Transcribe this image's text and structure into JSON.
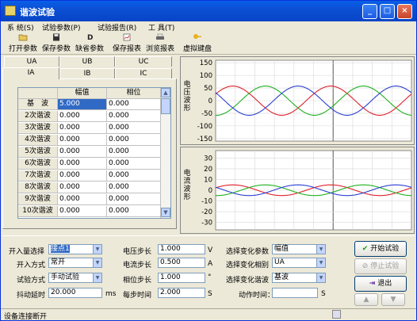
{
  "window": {
    "title": "谐波试验",
    "min": "_",
    "max": "□",
    "close": "×"
  },
  "menu": [
    "系 统(S)",
    "试验参数(P)",
    "试验报告(R)",
    "工 具(T)"
  ],
  "toolbar": [
    {
      "label": "打开参数",
      "icon": "folder-open-icon"
    },
    {
      "label": "保存参数",
      "icon": "floppy-icon"
    },
    {
      "label": "缺省参数",
      "icon": "default-icon"
    },
    {
      "label": "保存报表",
      "icon": "report-save-icon"
    },
    {
      "label": "浏览报表",
      "icon": "printer-icon"
    },
    {
      "label": "虚拟键盘",
      "icon": "key-icon"
    }
  ],
  "tabs": {
    "row1": [
      "UA",
      "UB",
      "UC"
    ],
    "row2": [
      "IA",
      "IB",
      "IC"
    ],
    "active": "IA"
  },
  "harmonic_table": {
    "headers": [
      "",
      "幅值",
      "相位"
    ],
    "rows": [
      [
        "基　波",
        "5.000",
        "0.000"
      ],
      [
        "2次谐波",
        "0.000",
        "0.000"
      ],
      [
        "3次谐波",
        "0.000",
        "0.000"
      ],
      [
        "4次谐波",
        "0.000",
        "0.000"
      ],
      [
        "5次谐波",
        "0.000",
        "0.000"
      ],
      [
        "6次谐波",
        "0.000",
        "0.000"
      ],
      [
        "7次谐波",
        "0.000",
        "0.000"
      ],
      [
        "8次谐波",
        "0.000",
        "0.000"
      ],
      [
        "9次谐波",
        "0.000",
        "0.000"
      ],
      [
        "10次谐波",
        "0.000",
        "0.000"
      ]
    ]
  },
  "chart_data": [
    {
      "type": "line",
      "ylabel": "电压波形",
      "yticks": [
        150,
        100,
        50,
        0,
        -50,
        -100,
        -150
      ],
      "ylim": [
        -160,
        160
      ],
      "amplitude": 57.7,
      "series": [
        {
          "phase_deg": 0,
          "color": "#e0202a"
        },
        {
          "phase_deg": -120,
          "color": "#20b020"
        },
        {
          "phase_deg": 120,
          "color": "#2a3fd0"
        }
      ]
    },
    {
      "type": "line",
      "ylabel": "电流波形",
      "yticks": [
        30,
        20,
        10,
        0,
        -10,
        -20,
        -30
      ],
      "ylim": [
        -37,
        37
      ],
      "amplitude": 5,
      "series": [
        {
          "phase_deg": 0,
          "color": "#e0202a"
        },
        {
          "phase_deg": -120,
          "color": "#20b020"
        },
        {
          "phase_deg": 120,
          "color": "#2a3fd0"
        }
      ]
    }
  ],
  "controls": {
    "input_select": {
      "label": "开入量选择",
      "value": "接点1"
    },
    "input_mode": {
      "label": "开入方式",
      "value": "常开"
    },
    "test_mode": {
      "label": "试验方式",
      "value": "手动试验"
    },
    "debounce": {
      "label": "抖动延时",
      "value": "20.000",
      "unit": "ms"
    },
    "voltage_step": {
      "label": "电压步长",
      "value": "1.000",
      "unit": "V"
    },
    "current_step": {
      "label": "电流步长",
      "value": "0.500",
      "unit": "A"
    },
    "phase_step": {
      "label": "相位步长",
      "value": "1.000",
      "unit": "°"
    },
    "step_time": {
      "label": "每步时间",
      "value": "2.000",
      "unit": "S"
    },
    "var_param": {
      "label": "选择变化参数",
      "value": "幅值"
    },
    "var_phase": {
      "label": "选择变化相别",
      "value": "UA"
    },
    "var_harmonic": {
      "label": "选择变化谐波",
      "value": "基波"
    },
    "action_time": {
      "label": "动作时间：",
      "value": "",
      "unit": "S"
    }
  },
  "buttons": {
    "start": "开始试验",
    "stop": "停止试验",
    "exit": "退出",
    "up": "▲",
    "down": "▼"
  },
  "status": {
    "text": "设备连接断开"
  }
}
